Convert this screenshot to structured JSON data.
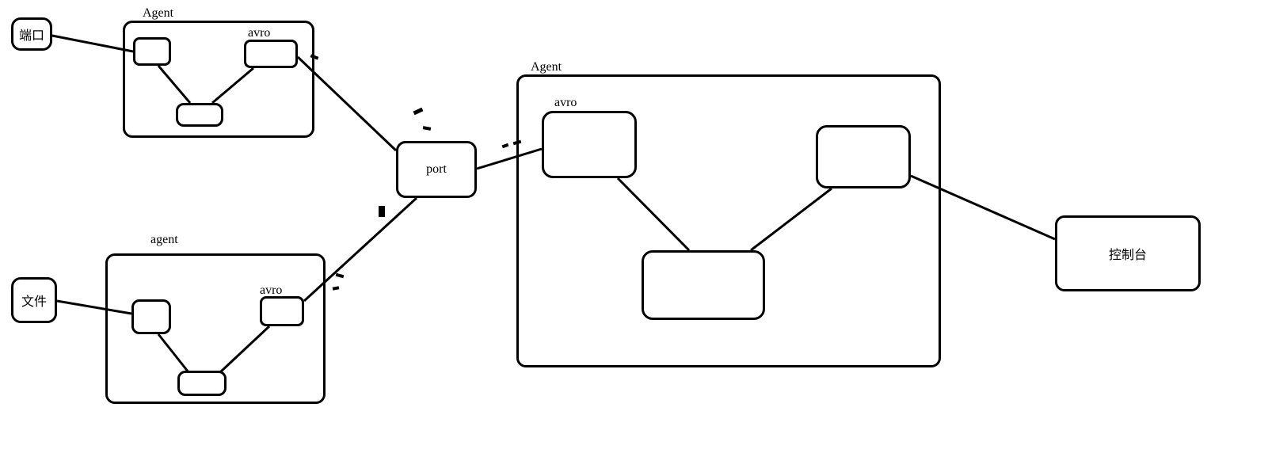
{
  "nodes": {
    "port_node": "端口",
    "file_node": "文件",
    "console_node": "控制台",
    "center_port": "port"
  },
  "labels": {
    "agent1_title": "Agent",
    "agent1_avro": "avro",
    "agent2_title": "agent",
    "agent2_avro": "avro",
    "agent3_title": "Agent",
    "agent3_avro": "avro"
  }
}
